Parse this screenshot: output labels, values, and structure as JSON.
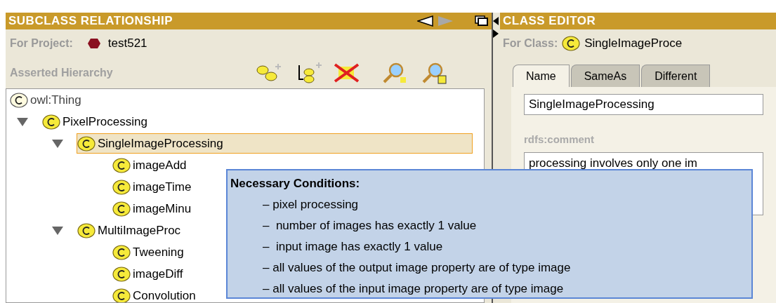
{
  "subclass_panel": {
    "title": "SUBCLASS RELATIONSHIP",
    "project_label": "For Project:",
    "project_name": "test521",
    "hierarchy_label": "Asserted Hierarchy",
    "tree": [
      {
        "label": "owl:Thing",
        "kind": "root",
        "selected": false,
        "children": [
          {
            "label": "PixelProcessing",
            "kind": "class",
            "expanded": true,
            "selected": false,
            "children": [
              {
                "label": "SingleImageProcessing",
                "kind": "class",
                "expanded": true,
                "selected": true,
                "children": [
                  {
                    "label": "imageAdd",
                    "kind": "class",
                    "selected": false
                  },
                  {
                    "label": "imageTime",
                    "kind": "class",
                    "selected": false
                  },
                  {
                    "label": "imageMinu",
                    "kind": "class",
                    "selected": false
                  }
                ]
              },
              {
                "label": "MultiImageProc",
                "kind": "class",
                "expanded": true,
                "selected": false,
                "children": [
                  {
                    "label": "Tweening",
                    "kind": "class",
                    "selected": false
                  },
                  {
                    "label": "imageDiff",
                    "kind": "class",
                    "selected": false
                  },
                  {
                    "label": "Convolution",
                    "kind": "class",
                    "selected": false
                  }
                ]
              }
            ]
          }
        ]
      }
    ]
  },
  "class_editor": {
    "title": "CLASS EDITOR",
    "class_label": "For Class:",
    "class_name": "SingleImageProce",
    "tabs": [
      {
        "label": "Name",
        "selected": true
      },
      {
        "label": "SameAs",
        "selected": false
      },
      {
        "label": "Different",
        "selected": false
      }
    ],
    "name_value": "SingleImageProcessing",
    "comment_label": "rdfs:comment",
    "comment_value": "processing involves only one im"
  },
  "tooltip": {
    "title": "Necessary Conditions:",
    "conditions": [
      "– pixel processing",
      "–  number of images has exactly 1 value",
      "–  input image has exactly 1 value",
      "– all values of the output image property are of type image",
      "– all values of the input image property are of type image"
    ]
  }
}
